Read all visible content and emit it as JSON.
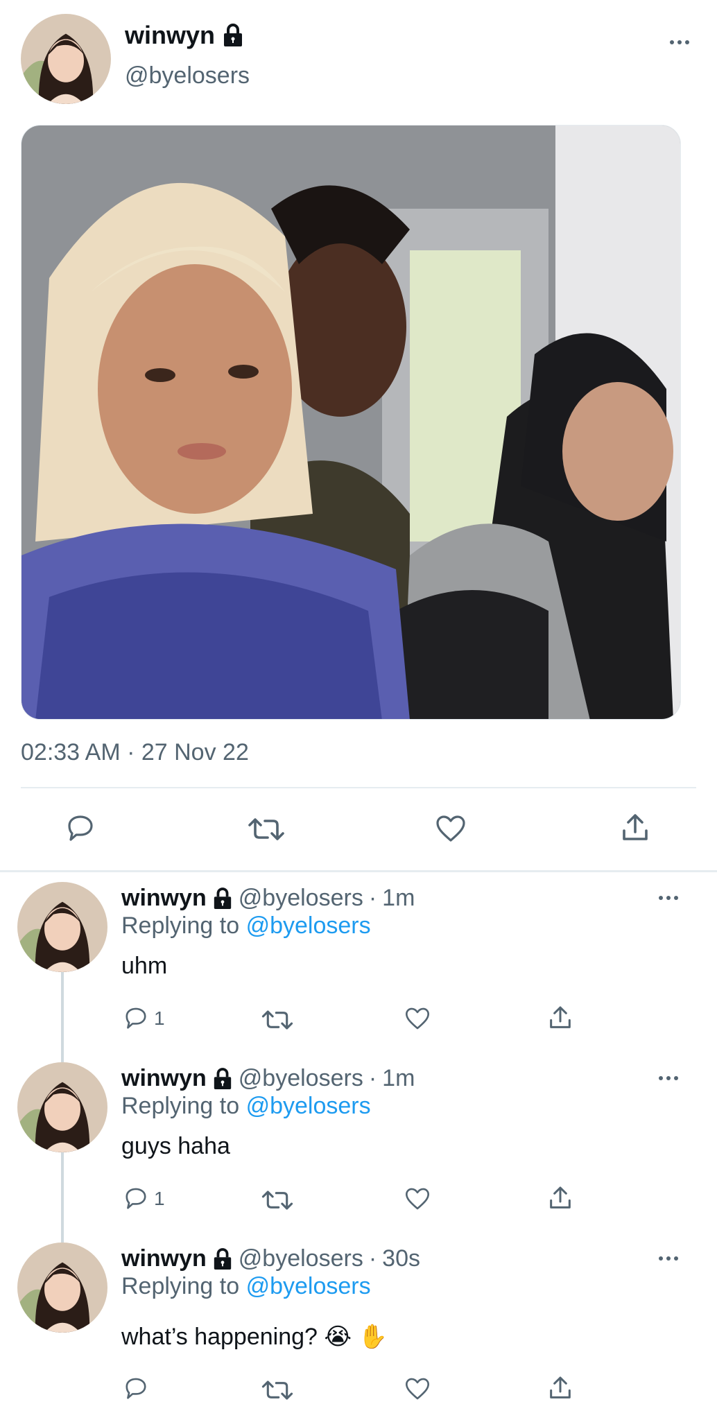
{
  "main_tweet": {
    "display_name": "winwyn",
    "handle": "@byelosers",
    "timestamp": "02:33 AM · 27 Nov 22",
    "actions": [
      "reply-icon",
      "retweet-icon",
      "like-icon",
      "share-icon"
    ]
  },
  "replies": [
    {
      "display_name": "winwyn",
      "handle": "@byelosers",
      "separator": "·",
      "age": "1m",
      "replying_prefix": "Replying to",
      "replying_to": "@byelosers",
      "text": "uhm",
      "reply_count": "1"
    },
    {
      "display_name": "winwyn",
      "handle": "@byelosers",
      "separator": "·",
      "age": "1m",
      "replying_prefix": "Replying to",
      "replying_to": "@byelosers",
      "text": "guys haha",
      "reply_count": "1"
    },
    {
      "display_name": "winwyn",
      "handle": "@byelosers",
      "separator": "·",
      "age": "30s",
      "replying_prefix": "Replying to",
      "replying_to": "@byelosers",
      "text": "what’s happening? 😭 ✋",
      "reply_count": ""
    }
  ],
  "colors": {
    "link": "#1d9bf0",
    "muted": "#536471",
    "divider": "#e6ecf0",
    "thread_line": "#cfd9de"
  }
}
